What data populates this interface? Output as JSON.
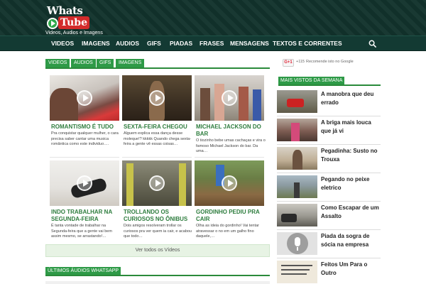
{
  "header": {
    "logo_whats": "Whats",
    "logo_tube": "Tube",
    "tagline": "Videos, Audios e Imagens"
  },
  "nav": {
    "items": [
      "VIDEOS",
      "IMAGENS",
      "AUDIOS",
      "GIFS",
      "PIADAS",
      "FRASES",
      "MENSAGENS",
      "TEXTOS E CORRENTES"
    ],
    "search_icon": "search-icon"
  },
  "tabs": [
    "VIDEOS",
    "AUDIOS",
    "GIFS",
    "IMAGENS"
  ],
  "videos": [
    {
      "title": "ROMANTISMO É TUDO",
      "desc": "Pra conquistar qualquer mulher, o cara precisa saber cantar uma musica romântica como este individuo…."
    },
    {
      "title": "SEXTA-FEIRA CHEGOU",
      "desc": "Alguem explica essa dança desse moleque!? kkkkk Quando chega sexta-feira a gente vê essas coisas…"
    },
    {
      "title": "MICHAEL JACKSON DO BAR",
      "desc": "O tiozinho bebe umas cachaças e vira o famoso Michael Jackson do bar. Da uma…"
    },
    {
      "title": "INDO TRABALHAR NA SEGUNDA-FEIRA",
      "desc": "É tanta vontade de trabalhar na Segunda-feira que a gente vai bem assim mesmo, se arrastando!…"
    },
    {
      "title": "TROLLANDO OS CURIOSOS NO ÔNIBUS",
      "desc": "Dois amigos resolveram trollar os curiosos pra ver quem ia cair, e acabou que todo…"
    },
    {
      "title": "GORDINHO PEDIU PRA CAIR",
      "desc": "Olha as ideia do gordinho! Vai tentar atravessar o no em um galho fino daquele,…"
    }
  ],
  "view_all": "Ver todos os Vídeos",
  "section2_label": "ÚLTIMOS ÁUDIOS WHATSAPP",
  "gplus": {
    "button": "G+1",
    "count": "+115",
    "text": "Recomende isto no Google"
  },
  "sidebar": {
    "heading": "MAIS VISTOS DA SEMANA",
    "items": [
      "A manobra que deu errado",
      "A briga mais louca que já vi",
      "Pegadinha: Susto no Trouxa",
      "Pegando no peixe eletrico",
      "Como Escapar de um Assalto",
      "Piada da sogra de sócia na empresa",
      "Feitos Um Para o Outro"
    ]
  },
  "colors": {
    "header_bg": "#12332c",
    "accent_green": "#2e9a47",
    "title_green": "#2e7d3e"
  }
}
